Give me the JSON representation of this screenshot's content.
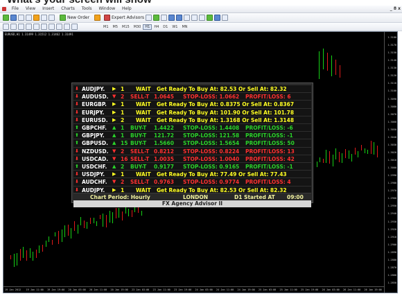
{
  "headline": "What's your screen will show",
  "app": {
    "menu": [
      "File",
      "View",
      "Insert",
      "Charts",
      "Tools",
      "Window",
      "Help"
    ],
    "toolbar": {
      "new_order": "New Order",
      "expert_advisors": "Expert Advisors",
      "timeframes": [
        "M1",
        "M5",
        "M15",
        "M30",
        "H1",
        "H4",
        "D1",
        "W1",
        "MN"
      ],
      "active_timeframe": "H1"
    },
    "window_controls": "_ 8 x"
  },
  "chart": {
    "title": "EURUSD,H1  1.31499  1.31512  1.31462  1.31491",
    "price_labels": [
      "1.3180",
      "1.3170",
      "1.3150",
      "1.3140",
      "1.3130",
      "1.3120",
      "1.3110",
      "1.3100",
      "1.3090",
      "1.3080",
      "1.3070",
      "1.3060",
      "1.3050",
      "1.3040",
      "1.3030",
      "1.3020",
      "1.3010",
      "1.3000",
      "1.2990",
      "1.2980",
      "1.2970",
      "1.2960",
      "1.2950",
      "1.2940",
      "1.2930",
      "1.2920",
      "1.2910",
      "1.2900",
      "1.2890",
      "1.2880",
      "1.2870",
      "1.2860",
      "1.2850"
    ],
    "time_labels": [
      "19 Jan 2012",
      "19 Jan 11:00",
      "19 Jan 19:00",
      "20 Jan 03:00",
      "20 Jan 11:00",
      "20 Jan 19:00",
      "23 Jan 03:00",
      "23 Jan 11:00",
      "23 Jan 19:00",
      "24 Jan 03:00",
      "24 Jan 11:00",
      "24 Jan 19:00",
      "25 Jan 03:00",
      "25 Jan 11:00",
      "25 Jan 19:00",
      "26 Jan 03:00",
      "26 Jan 11:00",
      "26 Jan 19:00"
    ]
  },
  "advisor": {
    "rows": [
      {
        "pair": "AUDJPY.",
        "dir": "neutral",
        "n": "1",
        "action": "WAIT",
        "msg": "Get Ready To Buy At: 82.53 Or Sell At: 82.32"
      },
      {
        "pair": "AUDUSD.",
        "dir": "sell",
        "n": "2",
        "action": "SELL-T",
        "price": "1.0645",
        "stop": "STOP-LOSS: 1.0662",
        "pl": "PROFIT/LOSS: 6"
      },
      {
        "pair": "EURGBP.",
        "dir": "neutral",
        "n": "1",
        "action": "WAIT",
        "msg": "Get Ready To Buy At: 0.8375 Or Sell At: 0.8367"
      },
      {
        "pair": "EURJPY.",
        "dir": "neutral",
        "n": "1",
        "action": "WAIT",
        "msg": "Get Ready To Buy At: 101.90 Or Sell At: 101.78"
      },
      {
        "pair": "EURUSD.",
        "dir": "neutral",
        "n": "2",
        "action": "WAIT",
        "msg": "Get Ready To Buy At: 1.3168 Or Sell At: 1.3148"
      },
      {
        "pair": "GBPCHF.",
        "dir": "buy",
        "n": "1",
        "action": "BUY-T",
        "price": "1.4422",
        "stop": "STOP-LOSS: 1.4408",
        "pl": "PROFIT/LOSS: -6"
      },
      {
        "pair": "GBPJPY.",
        "dir": "buy",
        "n": "1",
        "action": "BUY-T",
        "price": "121.72",
        "stop": "STOP-LOSS: 121.58",
        "pl": "PROFIT/LOSS: -1"
      },
      {
        "pair": "GBPUSD.",
        "dir": "buy",
        "n": "15",
        "action": "BUY-T",
        "price": "1.5660",
        "stop": "STOP-LOSS: 1.5654",
        "pl": "PROFIT/LOSS: 50"
      },
      {
        "pair": "NZDUSD.",
        "dir": "sell",
        "n": "2",
        "action": "SELL-T",
        "price": "0.8212",
        "stop": "STOP-LOSS: 0.8224",
        "pl": "PROFIT/LOSS: 13"
      },
      {
        "pair": "USDCAD.",
        "dir": "sell",
        "n": "16",
        "action": "SELL-T",
        "price": "1.0035",
        "stop": "STOP-LOSS: 1.0040",
        "pl": "PROFIT/LOSS: 42"
      },
      {
        "pair": "USDCHF.",
        "dir": "buy",
        "n": "2",
        "action": "BUY-T",
        "price": "0.9177",
        "stop": "STOP-LOSS: 0.9165",
        "pl": "PROFIT/LOSS: -1"
      },
      {
        "pair": "USDJPY.",
        "dir": "neutral",
        "n": "1",
        "action": "WAIT",
        "msg": "Get Ready To Buy At: 77.49 Or Sell At: 77.43"
      },
      {
        "pair": "AUDCHF.",
        "dir": "sell",
        "n": "2",
        "action": "SELL-T",
        "price": "0.9763",
        "stop": "STOP-LOSS: 0.9774",
        "pl": "PROFIT/LOSS: 4"
      },
      {
        "pair": "AUDJPY.",
        "dir": "neutral",
        "n": "1",
        "action": "WAIT",
        "msg": "Get Ready To Buy At: 82.53 Or Sell At: 82.32"
      }
    ],
    "footer": {
      "chart_period": "Chart Period: Hourly",
      "session": "LONDON",
      "d1": "D1 Started AT",
      "time": "09:00"
    },
    "product_name": "FX Agency Advisor II"
  },
  "colors": {
    "buy": "#2ad42a",
    "sell": "#ff3030",
    "wait": "#ffff22",
    "chart_bg": "#000000"
  }
}
